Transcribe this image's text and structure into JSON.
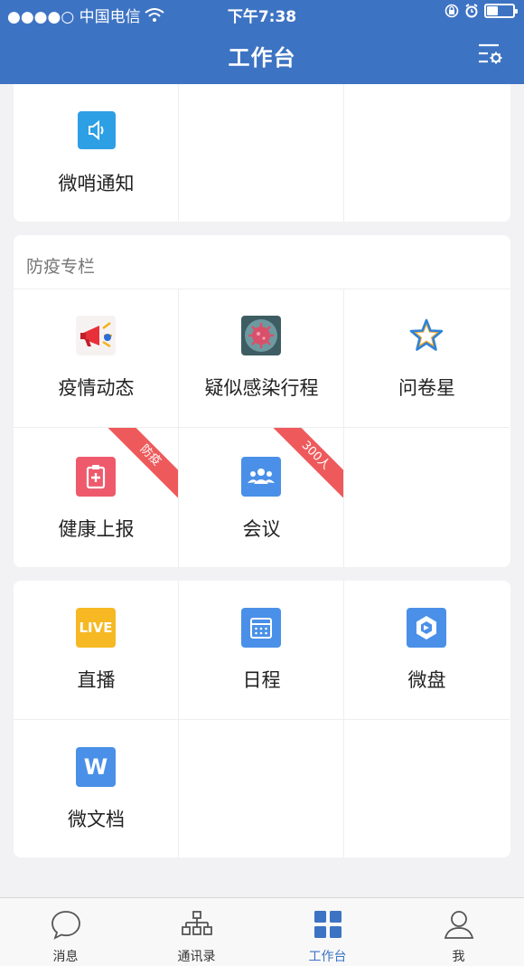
{
  "status_bar": {
    "carrier": "●●●●○ 中国电信",
    "time": "下午7:38"
  },
  "nav": {
    "title": "工作台"
  },
  "cards": {
    "first": {
      "items": [
        {
          "label": "微哨通知",
          "icon": "speaker-icon"
        }
      ]
    },
    "epidemic": {
      "title": "防疫专栏",
      "items": [
        {
          "label": "疫情动态",
          "icon": "megaphone-icon"
        },
        {
          "label": "疑似感染行程",
          "icon": "virus-icon"
        },
        {
          "label": "问卷星",
          "icon": "star-icon"
        },
        {
          "label": "健康上报",
          "icon": "health-report-icon",
          "ribbon": "防疫"
        },
        {
          "label": "会议",
          "icon": "meeting-icon",
          "ribbon": "300人"
        }
      ]
    },
    "tools": {
      "items": [
        {
          "label": "直播",
          "icon": "live-icon",
          "icon_text": "LIVE"
        },
        {
          "label": "日程",
          "icon": "calendar-icon"
        },
        {
          "label": "微盘",
          "icon": "cloud-disk-icon"
        },
        {
          "label": "微文档",
          "icon": "document-icon",
          "icon_text": "W"
        }
      ]
    }
  },
  "tabbar": {
    "items": [
      {
        "label": "消息",
        "icon": "chat-bubble-icon"
      },
      {
        "label": "通讯录",
        "icon": "org-chart-icon"
      },
      {
        "label": "工作台",
        "icon": "grid-icon",
        "active": true
      },
      {
        "label": "我",
        "icon": "person-icon"
      }
    ]
  },
  "colors": {
    "primary": "#3d73c3",
    "ribbon": "#ee5a5c",
    "live": "#f6b823",
    "blue_icon": "#4a90e8",
    "health": "#ee5a6c"
  }
}
